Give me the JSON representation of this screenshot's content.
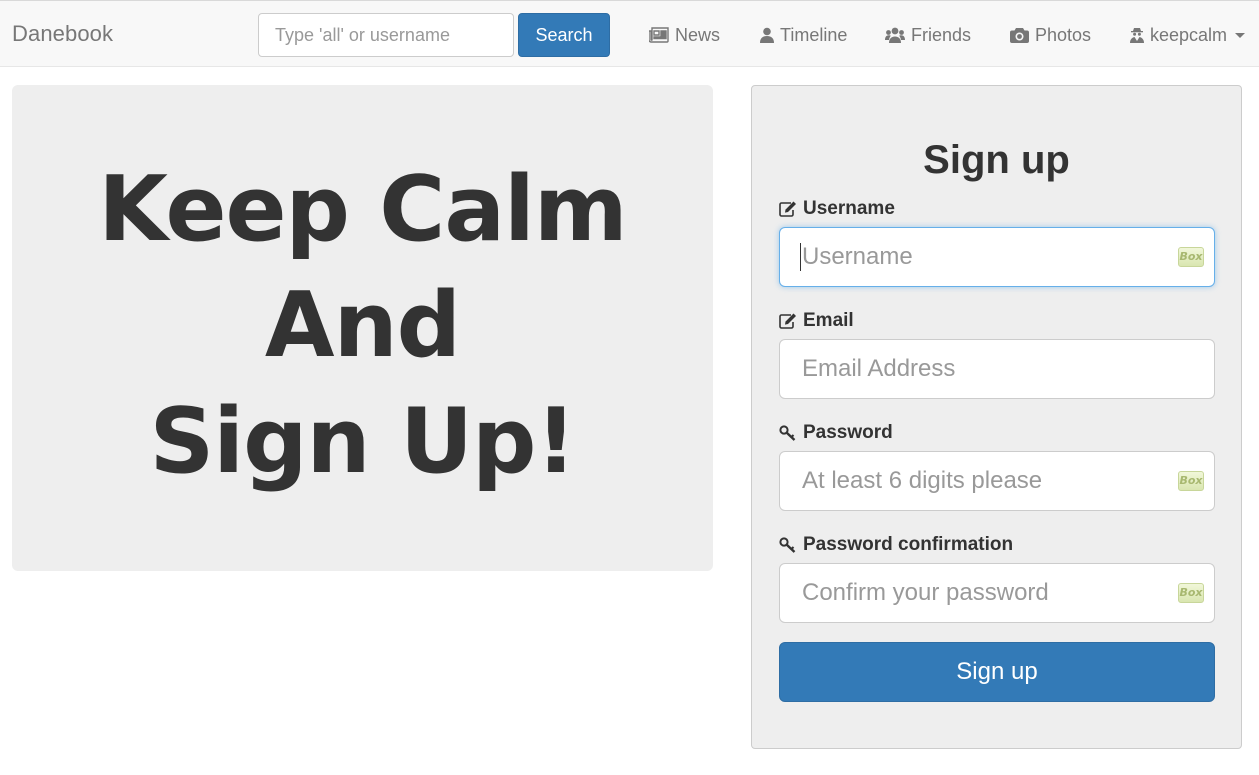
{
  "navbar": {
    "brand": "Danebook",
    "search_placeholder": "Type 'all' or username",
    "search_button": "Search",
    "links": {
      "news": "News",
      "timeline": "Timeline",
      "friends": "Friends",
      "photos": "Photos",
      "user": "keepcalm"
    }
  },
  "hero": {
    "line1": "Keep Calm",
    "line2": "And",
    "line3": "Sign Up!"
  },
  "signup": {
    "title": "Sign up",
    "username_label": "Username",
    "username_placeholder": "Username",
    "email_label": "Email",
    "email_placeholder": "Email Address",
    "password_label": "Password",
    "password_placeholder": "At least 6 digits please",
    "confirm_label": "Password confirmation",
    "confirm_placeholder": "Confirm your password",
    "submit": "Sign up",
    "autofill_badge": "Box"
  },
  "colors": {
    "primary": "#337ab7",
    "panel_bg": "#eeeeee",
    "navbar_bg": "#f8f8f8"
  }
}
